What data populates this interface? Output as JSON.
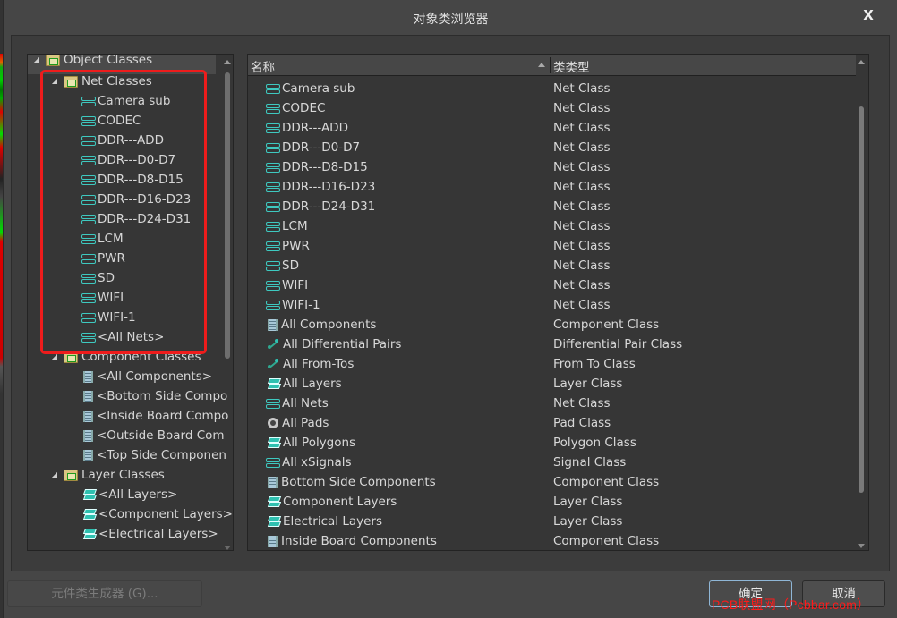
{
  "window": {
    "title": "对象类浏览器",
    "close_label": "X"
  },
  "tree": {
    "root": {
      "label": "Object Classes",
      "expanded": true
    },
    "groups": [
      {
        "label": "Net Classes",
        "icon": "net-folder-icon",
        "expanded": true,
        "items": [
          {
            "label": "Camera sub",
            "icon": "net-icon"
          },
          {
            "label": "CODEC",
            "icon": "net-icon"
          },
          {
            "label": "DDR---ADD",
            "icon": "net-icon"
          },
          {
            "label": "DDR---D0-D7",
            "icon": "net-icon"
          },
          {
            "label": "DDR---D8-D15",
            "icon": "net-icon"
          },
          {
            "label": "DDR---D16-D23",
            "icon": "net-icon"
          },
          {
            "label": "DDR---D24-D31",
            "icon": "net-icon"
          },
          {
            "label": "LCM",
            "icon": "net-icon"
          },
          {
            "label": "PWR",
            "icon": "net-icon"
          },
          {
            "label": "SD",
            "icon": "net-icon"
          },
          {
            "label": "WIFI",
            "icon": "net-icon"
          },
          {
            "label": "WIFI-1",
            "icon": "net-icon"
          },
          {
            "label": "<All Nets>",
            "icon": "net-icon"
          }
        ]
      },
      {
        "label": "Component Classes",
        "icon": "component-folder-icon",
        "expanded": true,
        "items": [
          {
            "label": "<All Components>",
            "icon": "component-icon"
          },
          {
            "label": "<Bottom Side Compo",
            "icon": "component-icon"
          },
          {
            "label": "<Inside Board Compo",
            "icon": "component-icon"
          },
          {
            "label": "<Outside Board Com",
            "icon": "component-icon"
          },
          {
            "label": "<Top Side Componen",
            "icon": "component-icon"
          }
        ]
      },
      {
        "label": "Layer Classes",
        "icon": "layer-folder-icon",
        "expanded": true,
        "items": [
          {
            "label": "<All Layers>",
            "icon": "layer-icon"
          },
          {
            "label": "<Component Layers>",
            "icon": "layer-icon"
          },
          {
            "label": "<Electrical Layers>",
            "icon": "layer-icon"
          }
        ]
      }
    ]
  },
  "list": {
    "columns": {
      "name": "名称",
      "type": "类类型"
    },
    "rows": [
      {
        "name": "Camera sub",
        "type": "Net Class",
        "icon": "net-icon"
      },
      {
        "name": "CODEC",
        "type": "Net Class",
        "icon": "net-icon"
      },
      {
        "name": "DDR---ADD",
        "type": "Net Class",
        "icon": "net-icon"
      },
      {
        "name": "DDR---D0-D7",
        "type": "Net Class",
        "icon": "net-icon"
      },
      {
        "name": "DDR---D8-D15",
        "type": "Net Class",
        "icon": "net-icon"
      },
      {
        "name": "DDR---D16-D23",
        "type": "Net Class",
        "icon": "net-icon"
      },
      {
        "name": "DDR---D24-D31",
        "type": "Net Class",
        "icon": "net-icon"
      },
      {
        "name": "LCM",
        "type": "Net Class",
        "icon": "net-icon"
      },
      {
        "name": "PWR",
        "type": "Net Class",
        "icon": "net-icon"
      },
      {
        "name": "SD",
        "type": "Net Class",
        "icon": "net-icon"
      },
      {
        "name": "WIFI",
        "type": "Net Class",
        "icon": "net-icon"
      },
      {
        "name": "WIFI-1",
        "type": "Net Class",
        "icon": "net-icon"
      },
      {
        "name": "All Components",
        "type": "Component Class",
        "icon": "component-icon"
      },
      {
        "name": "All Differential Pairs",
        "type": "Differential Pair Class",
        "icon": "differential-pair-icon"
      },
      {
        "name": "All From-Tos",
        "type": "From To Class",
        "icon": "differential-pair-icon"
      },
      {
        "name": "All Layers",
        "type": "Layer Class",
        "icon": "layer-icon"
      },
      {
        "name": "All Nets",
        "type": "Net Class",
        "icon": "net-icon"
      },
      {
        "name": "All Pads",
        "type": "Pad Class",
        "icon": "pad-icon"
      },
      {
        "name": "All Polygons",
        "type": "Polygon Class",
        "icon": "layer-icon"
      },
      {
        "name": "All xSignals",
        "type": "Signal Class",
        "icon": "net-icon"
      },
      {
        "name": "Bottom Side Components",
        "type": "Component Class",
        "icon": "component-icon"
      },
      {
        "name": "Component Layers",
        "type": "Layer Class",
        "icon": "layer-icon"
      },
      {
        "name": "Electrical Layers",
        "type": "Layer Class",
        "icon": "layer-icon"
      },
      {
        "name": "Inside Board Components",
        "type": "Component Class",
        "icon": "component-icon"
      }
    ]
  },
  "buttons": {
    "generator": "元件类生成器 (G)...",
    "ok": "确定",
    "cancel": "取消"
  },
  "watermark": "PCB联盟网（Pcbbar.com）",
  "colors": {
    "highlight_box": "#ee1c1c",
    "net_icon": "#3ec9c0",
    "ok_border": "#8fb6d6"
  }
}
